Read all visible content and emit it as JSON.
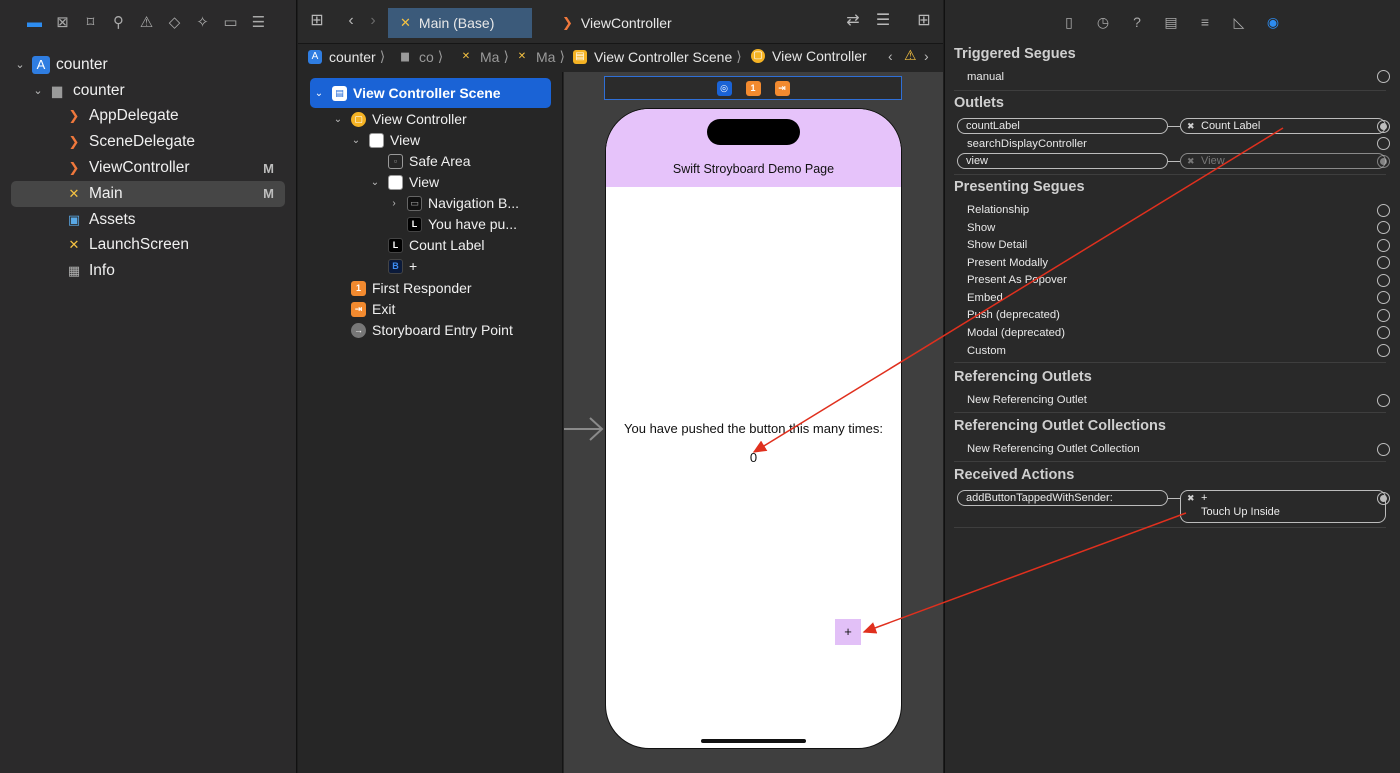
{
  "navigator": {
    "toolbar_icons": [
      "folder-icon",
      "source-control-icon",
      "bookmark-icon",
      "search-icon",
      "warning-icon",
      "test-icon",
      "debug-icon",
      "breakpoint-icon",
      "report-icon"
    ],
    "tree": [
      {
        "label": "counter",
        "icon": "project-icon",
        "badge": ""
      },
      {
        "label": "counter",
        "icon": "folder-icon",
        "badge": ""
      },
      {
        "label": "AppDelegate",
        "icon": "swift-icon",
        "badge": ""
      },
      {
        "label": "SceneDelegate",
        "icon": "swift-icon",
        "badge": ""
      },
      {
        "label": "ViewController",
        "icon": "swift-icon",
        "badge": "M"
      },
      {
        "label": "Main",
        "icon": "storyboard-icon",
        "badge": "M"
      },
      {
        "label": "Assets",
        "icon": "assets-icon",
        "badge": ""
      },
      {
        "label": "LaunchScreen",
        "icon": "storyboard-icon",
        "badge": ""
      },
      {
        "label": "Info",
        "icon": "plist-icon",
        "badge": ""
      }
    ]
  },
  "editor": {
    "tabs": [
      {
        "label": "Main (Base)",
        "icon": "storyboard-icon"
      },
      {
        "label": "ViewController",
        "icon": "swift-icon"
      }
    ],
    "jumpbar": [
      {
        "label": "counter",
        "icon": "project-icon"
      },
      {
        "label": "co",
        "icon": "folder-icon"
      },
      {
        "label": "Ma",
        "icon": "storyboard-icon"
      },
      {
        "label": "Ma",
        "icon": "storyboard-icon"
      },
      {
        "label": "View Controller Scene",
        "icon": "scene-icon"
      },
      {
        "label": "View Controller",
        "icon": "view-controller-icon"
      }
    ],
    "outline": [
      {
        "label": "View Controller Scene"
      },
      {
        "label": "View Controller"
      },
      {
        "label": "View"
      },
      {
        "label": "Safe Area"
      },
      {
        "label": "View"
      },
      {
        "label": "Navigation B..."
      },
      {
        "label": "You have pu..."
      },
      {
        "label": "Count Label"
      },
      {
        "label": "+"
      },
      {
        "label": "First Responder"
      },
      {
        "label": "Exit"
      },
      {
        "label": "Storyboard Entry Point"
      }
    ],
    "outline_glyphs": {
      "label": "L",
      "button": "B",
      "first_responder": "1"
    },
    "phone": {
      "nav_title": "Swift Stroyboard Demo Page",
      "pushed_text": "You have pushed the button this many times:",
      "count": "0",
      "button": "+"
    }
  },
  "inspector": {
    "sections": {
      "triggered_segues": "Triggered Segues",
      "outlets": "Outlets",
      "presenting_segues": "Presenting Segues",
      "referencing_outlets": "Referencing Outlets",
      "referencing_outlet_collections": "Referencing Outlet Collections",
      "received_actions": "Received Actions"
    },
    "triggered": {
      "manual": "manual"
    },
    "outlets": {
      "countLabel": "countLabel",
      "countLabel_target": "Count Label",
      "searchDisplayController": "searchDisplayController",
      "view": "view",
      "view_target": "View"
    },
    "presenting": [
      "Relationship",
      "Show",
      "Show Detail",
      "Present Modally",
      "Present As Popover",
      "Embed",
      "Push (deprecated)",
      "Modal (deprecated)",
      "Custom"
    ],
    "referencing": {
      "new": "New Referencing Outlet"
    },
    "referencing_collection": {
      "new": "New Referencing Outlet Collection"
    },
    "actions": {
      "method": "addButtonTappedWithSender:",
      "target": "+",
      "event": "Touch Up Inside"
    }
  },
  "colors": {
    "accent": "#1a63d6",
    "nav_header": "#e6c3fa",
    "connection_arrow": "#e0301e"
  }
}
